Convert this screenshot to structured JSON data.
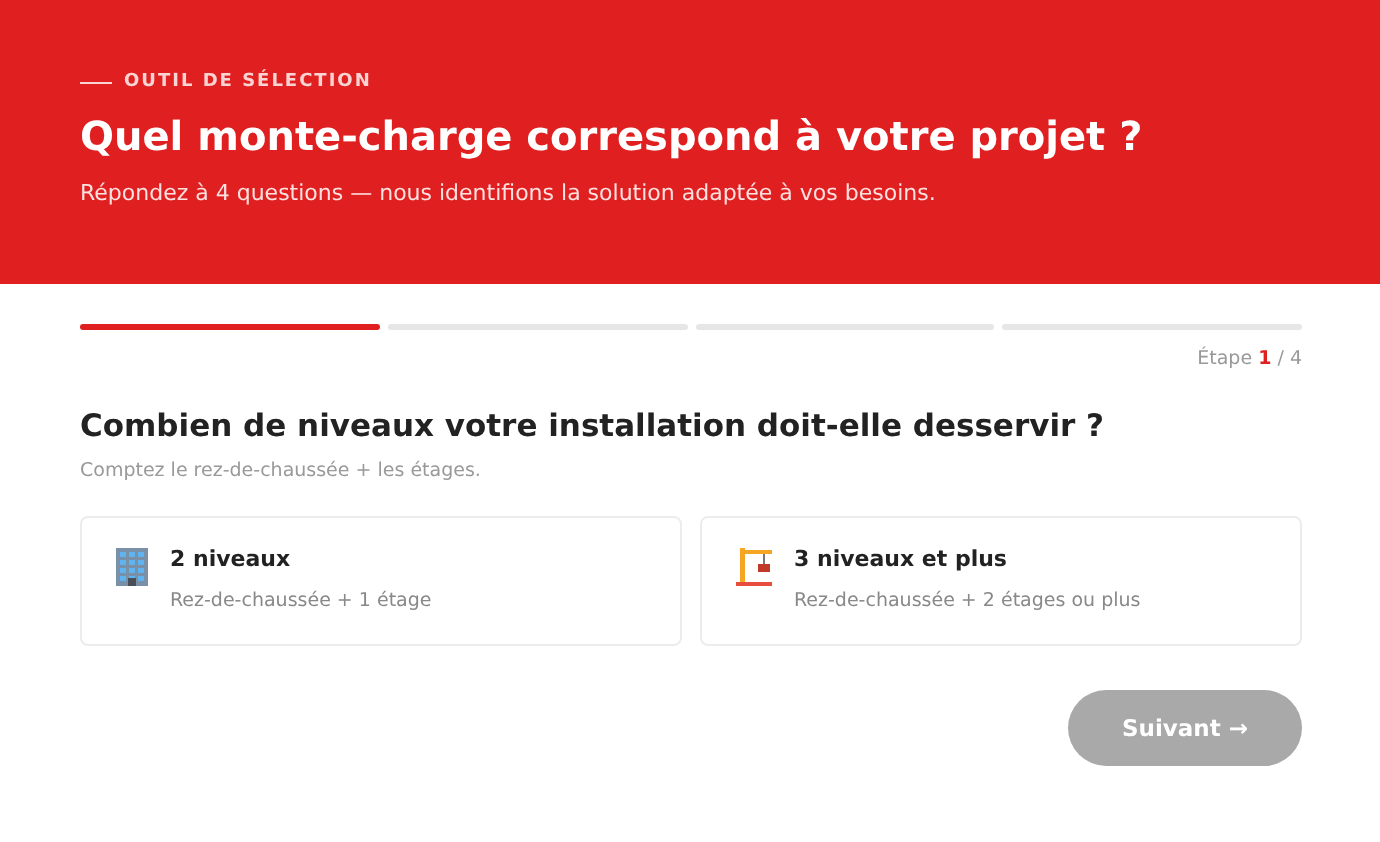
{
  "header": {
    "eyebrow": "OUTIL DE SÉLECTION",
    "title": "Quel monte-charge correspond à votre projet ?",
    "subtitle": "Répondez à 4 questions — nous identifions la solution adaptée à vos besoins."
  },
  "progress": {
    "segments": [
      {
        "active": true
      },
      {
        "active": false
      },
      {
        "active": false
      },
      {
        "active": false
      }
    ],
    "step_label": "Étape",
    "step_current": "1",
    "step_total": "/ 4"
  },
  "question": {
    "title": "Combien de niveaux votre installation doit-elle desservir ?",
    "hint": "Comptez le rez-de-chaussée + les étages."
  },
  "options": [
    {
      "kind": "building",
      "title": "2 niveaux",
      "description": "Rez-de-chaussée + 1 étage",
      "selected": false
    },
    {
      "kind": "crane",
      "title": "3 niveaux et plus",
      "description": "Rez-de-chaussée + 2 étages ou plus",
      "selected": false
    }
  ],
  "next_button": {
    "label": "Suivant →",
    "disabled": true
  }
}
